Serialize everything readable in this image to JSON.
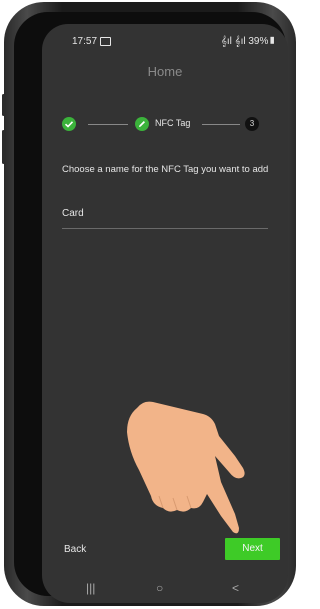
{
  "status_bar": {
    "time": "17:57",
    "right": "𝄞ıl 𝄞ıl 39%▮"
  },
  "header": {
    "title": "Home"
  },
  "stepper": {
    "steps": [
      {
        "state": "done",
        "label": ""
      },
      {
        "state": "current",
        "label": "NFC Tag"
      },
      {
        "state": "pending",
        "label": "3"
      }
    ]
  },
  "form": {
    "prompt": "Choose a name for the NFC Tag you want to add",
    "name_value": "Card"
  },
  "footer": {
    "back_label": "Back",
    "next_label": "Next"
  },
  "system_nav": {
    "recents": "|||",
    "home": "○",
    "back": "<"
  },
  "colors": {
    "accent": "#3ecb27",
    "screen_bg": "#333333",
    "step_done": "#3bb33b"
  }
}
